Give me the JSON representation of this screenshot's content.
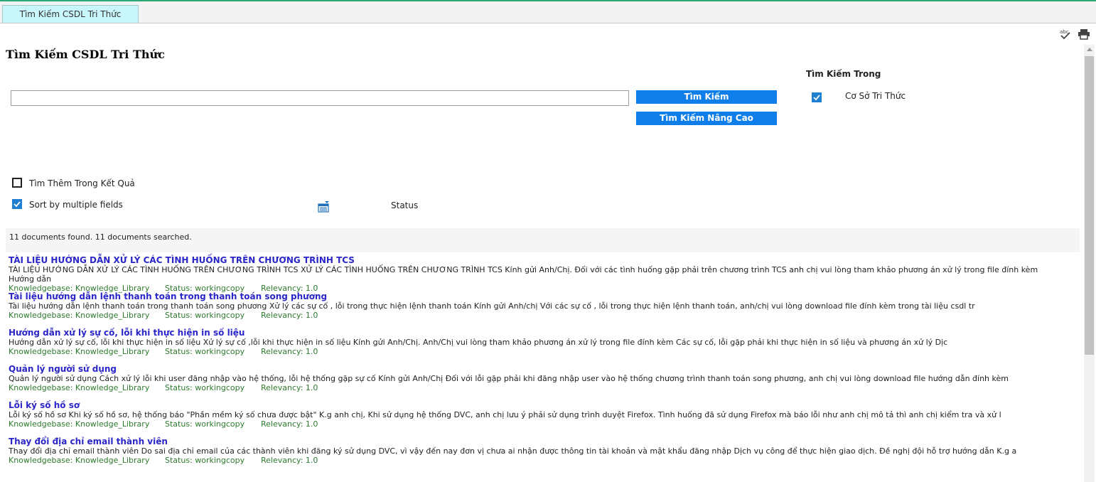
{
  "tab": {
    "label": "Tìm Kiếm CSDL Tri Thức"
  },
  "toolbar": {
    "spellcheck_icon": "spellcheck-icon",
    "print_icon": "print-icon"
  },
  "page": {
    "title": "Tìm Kiếm CSDL Tri Thức"
  },
  "search": {
    "query": "",
    "search_button": "Tìm Kiếm",
    "advanced_button": "Tìm Kiếm Nâng Cao"
  },
  "scope": {
    "heading": "Tìm Kiếm Trong",
    "knowledge_base": {
      "label": "Cơ Sở Tri Thức",
      "checked": true
    }
  },
  "options": {
    "search_within": {
      "label": "Tìm Thêm Trong Kết Quả",
      "checked": false
    },
    "sort_multiple": {
      "label": "Sort by multiple fields",
      "checked": true
    },
    "sort_field": "Status"
  },
  "results_summary": "11 documents found. 11 documents searched.",
  "results": [
    {
      "title": "TÀI LIỆU HƯỚNG DẪN XỬ LÝ CÁC TÌNH HUỐNG TRÊN CHƯƠNG TRÌNH TCS",
      "snippet": "TÀI LIỆU HƯỚNG DẪN XỬ LÝ CÁC TÌNH HUỐNG TRÊN CHƯƠNG TRÌNH TCS XỬ LÝ CÁC TÌNH HUỐNG TRÊN CHƯƠNG TRÌNH TCS Kính gửi Anh/Chị. Đối với các tình huống gặp phải trên chương trình TCS anh chị vui lòng tham khảo phương án xử lý trong file đính kèm Hướng dẫn",
      "kb": "Knowledgebase: Knowledge_Library",
      "status": "Status: workingcopy",
      "relevancy": "Relevancy: 1.0"
    },
    {
      "title": "Tài liệu hướng dẫn lệnh thanh toán trong thanh toán song phương",
      "snippet": "Tài liệu hướng dẫn lệnh thanh toán trong thanh toán song phương Xử lý các sự cố , lỗi trong thực hiện lệnh thanh toán Kính gửi Anh/chị Với các sự cố , lỗi trong thực hiện lệnh thanh toán, anh/chị vui lòng download file đính kèm trong tài liệu csdl tr",
      "kb": "Knowledgebase: Knowledge_Library",
      "status": "Status: workingcopy",
      "relevancy": "Relevancy: 1.0"
    },
    {
      "title": "Hướng dẫn xử lý sự cố, lỗi khi thực hiện in số liệu",
      "snippet": "Hướng dẫn xử lý sự cố, lỗi khi thực hiện in số liệu Xử lý sự cố ,lỗi khi thực hiện in số liệu Kính gửi Anh/Chị. Anh/Chị vui lòng tham khảo phương án xử lý trong file đính kèm Các sự cố, lỗi gặp phải khi thực hiện in số liệu và phương án xử lý Dịc",
      "kb": "Knowledgebase: Knowledge_Library",
      "status": "Status: workingcopy",
      "relevancy": "Relevancy: 1.0"
    },
    {
      "title": "Quản lý người sử dụng",
      "snippet": "Quản lý người sử dụng Cách xử lý lỗi khi user đăng nhập vào hệ thống, lỗi hệ thống gặp sự cố Kính gửi Anh/Chị Đối với lỗi gặp phải khi đăng nhập user vào hệ thống chương trình thanh toán song phương, anh chị vui lòng download file hướng dẫn đính kèm",
      "kb": "Knowledgebase: Knowledge_Library",
      "status": "Status: workingcopy",
      "relevancy": "Relevancy: 1.0"
    },
    {
      "title": "Lỗi ký số hồ sơ",
      "snippet": "Lỗi ký số hồ sơ Khi ký số hồ sơ, hệ thống báo \"Phần mềm ký số chưa được bật\" K.g anh chị, Khi sử dụng hệ thống DVC, anh chị lưu ý phải sử dụng trình duyệt Firefox. Tình huống đã sử dụng Firefox mà báo lỗi như anh chị mô tả thì anh chị kiểm tra và xử l",
      "kb": "Knowledgebase: Knowledge_Library",
      "status": "Status: workingcopy",
      "relevancy": "Relevancy: 1.0"
    },
    {
      "title": "Thay đổi địa chỉ email thành viên",
      "snippet": "Thay đổi địa chỉ email thành viên Do sai địa chỉ email của các thành viên khi đăng ký sử dụng DVC, vì vậy đến nay đơn vị chưa ai nhận được thông tin tài khoản và mật khẩu đăng nhập Dịch vụ công để thực hiện giao dịch. Đề nghị đội hỗ trợ hướng dẫn K.g a",
      "kb": "Knowledgebase: Knowledge_Library",
      "status": "Status: workingcopy",
      "relevancy": "Relevancy: 1.0"
    }
  ]
}
